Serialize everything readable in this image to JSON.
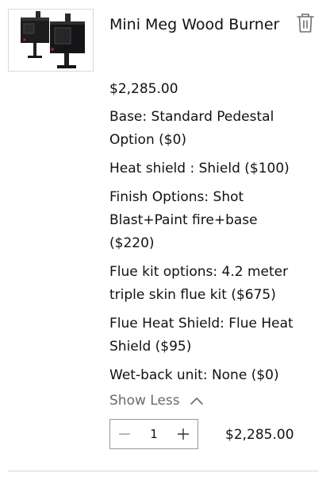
{
  "item": {
    "image_alt": "Mini Meg Wood Burner product image",
    "title": "Mini Meg Wood Burner",
    "price": "$2,285.00",
    "options": [
      "Base: Standard Pedestal Option ($0)",
      "Heat shield : Shield ($100)",
      "Finish Options: Shot Blast+Paint fire+base ($220)",
      "Flue kit options: 4.2 meter triple skin flue kit ($675)",
      "Flue Heat Shield: Flue Heat Shield ($95)",
      "Wet-back unit: None ($0)"
    ],
    "toggle_label": "Show Less",
    "quantity": "1",
    "line_total": "$2,285.00"
  },
  "icons": {
    "remove": "trash-icon",
    "toggle": "chevron-up-icon",
    "decrease": "minus-icon",
    "increase": "plus-icon"
  }
}
